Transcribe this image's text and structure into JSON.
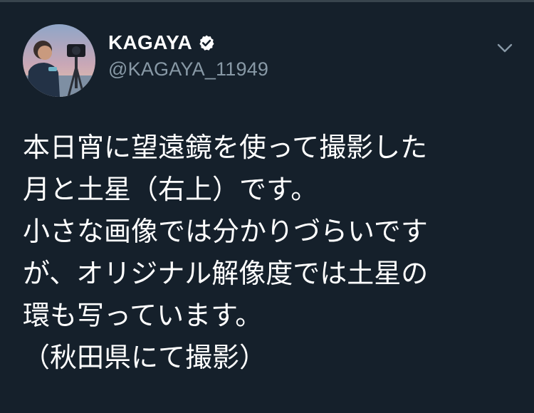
{
  "author": {
    "display_name": "KAGAYA",
    "handle": "@KAGAYA_11949",
    "verified": true
  },
  "icons": {
    "avatar": "profile-photo",
    "verified": "verified-badge-icon",
    "menu": "chevron-down-icon"
  },
  "tweet": {
    "lines": [
      "本日宵に望遠鏡を使って撮影した",
      "月と土星（右上）です。",
      "小さな画像では分かりづらいです",
      "が、オリジナル解像度では土星の",
      "環も写っています。",
      "（秋田県にて撮影）"
    ]
  },
  "colors": {
    "background": "#15202b",
    "text": "#ffffff",
    "secondary_text": "#8899a6"
  }
}
